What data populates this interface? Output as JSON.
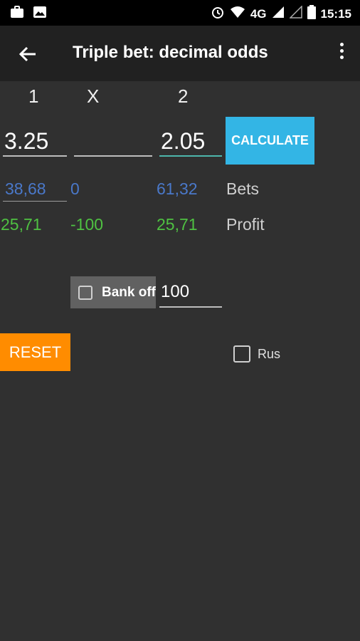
{
  "status_bar": {
    "time": "15:15",
    "network": "4G"
  },
  "toolbar": {
    "title": "Triple bet: decimal odds"
  },
  "headers": {
    "col1": "1",
    "colx": "X",
    "col2": "2"
  },
  "odds": {
    "odd1": "3.25",
    "oddx": "",
    "odd2": "2.05"
  },
  "calculate_label": "CALCULATE",
  "bets": {
    "label": "Bets",
    "v1": "38,68",
    "vx": "0",
    "v2": "61,32"
  },
  "profit": {
    "label": "Profit",
    "v1": "25,71",
    "vx": "-100",
    "v2": "25,71"
  },
  "bank": {
    "label": "Bank off",
    "value": "100",
    "checked": false
  },
  "reset_label": "RESET",
  "rus": {
    "label": "Rus",
    "checked": false
  },
  "colors": {
    "accent_blue": "#33b5e5",
    "reset_orange": "#ff8c00",
    "bets_blue": "#4a78c9",
    "profit_green": "#4fc142"
  }
}
